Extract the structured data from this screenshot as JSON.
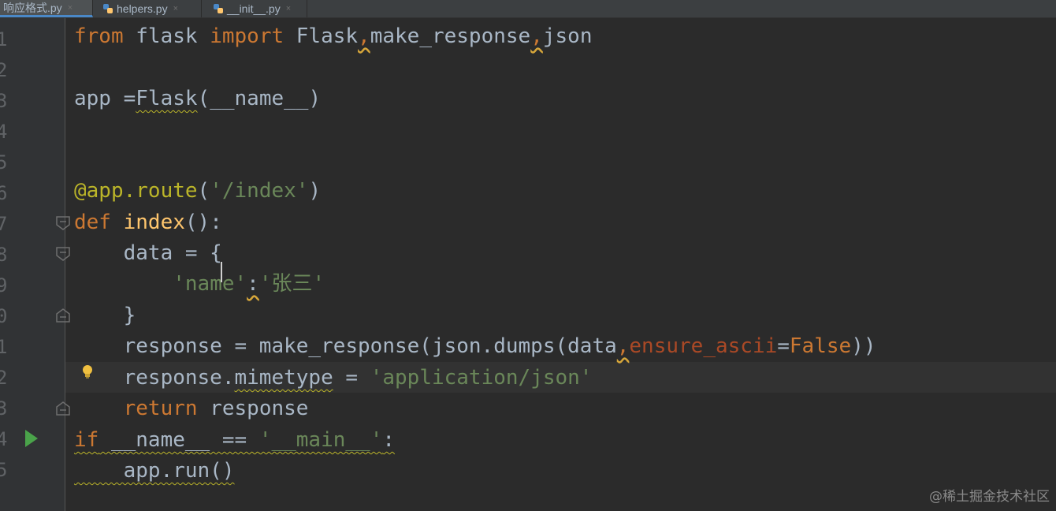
{
  "tabs": [
    {
      "label": "响应格式.py",
      "active": true
    },
    {
      "label": "helpers.py",
      "active": false
    },
    {
      "label": "__init__.py",
      "active": false
    }
  ],
  "close_glyph": "×",
  "line_numbers": [
    "1",
    "2",
    "3",
    "4",
    "5",
    "6",
    "7",
    "8",
    "9",
    "0",
    "1",
    "2",
    "3",
    "4",
    "5"
  ],
  "code": {
    "l1": {
      "kw1": "from",
      "mod": " flask ",
      "kw2": "import",
      "rest1": " Flask",
      "c1": ",",
      "rest2": "make_response",
      "c2": ",",
      "rest3": "json"
    },
    "l3": {
      "a": "app =",
      "b": "Flask",
      "c": "(__name__)"
    },
    "l6": {
      "dec": "@app.route",
      "p1": "(",
      "s": "'/index'",
      "p2": ")"
    },
    "l7": {
      "kw": "def",
      "fn": " index",
      "rest": "():"
    },
    "l8": {
      "t": "    data = {"
    },
    "l9": {
      "pad": "        ",
      "s1": "'name'",
      "colon": ":",
      "s2": "'张三'"
    },
    "l10": {
      "t": "    }"
    },
    "l11": {
      "a": "    response = make_response(json.dumps(data",
      "c": ",",
      "p": "ensure_ascii",
      "eq": "=",
      "f": "False",
      "e": "))"
    },
    "l12": {
      "a": "    response.",
      "b": "mimetype",
      "c": " = ",
      "s": "'application/json'"
    },
    "l13": {
      "kw": "    return",
      "rest": " response"
    },
    "l14": {
      "kw": "if",
      "a": " __name__ == ",
      "s": "'__main__'",
      "b": ":"
    },
    "l15": {
      "t": "    app.run()"
    }
  },
  "colors": {
    "keyword": "#cc7832",
    "function": "#ffc66d",
    "decorator": "#bbb529",
    "string": "#6a8759",
    "parameter": "#aa4926",
    "text": "#a9b7c6"
  },
  "icons": [
    "python-file-icon",
    "fold-marker-icon",
    "lightbulb-icon",
    "run-arrow-icon"
  ],
  "watermark": "@稀土掘金技术社区"
}
